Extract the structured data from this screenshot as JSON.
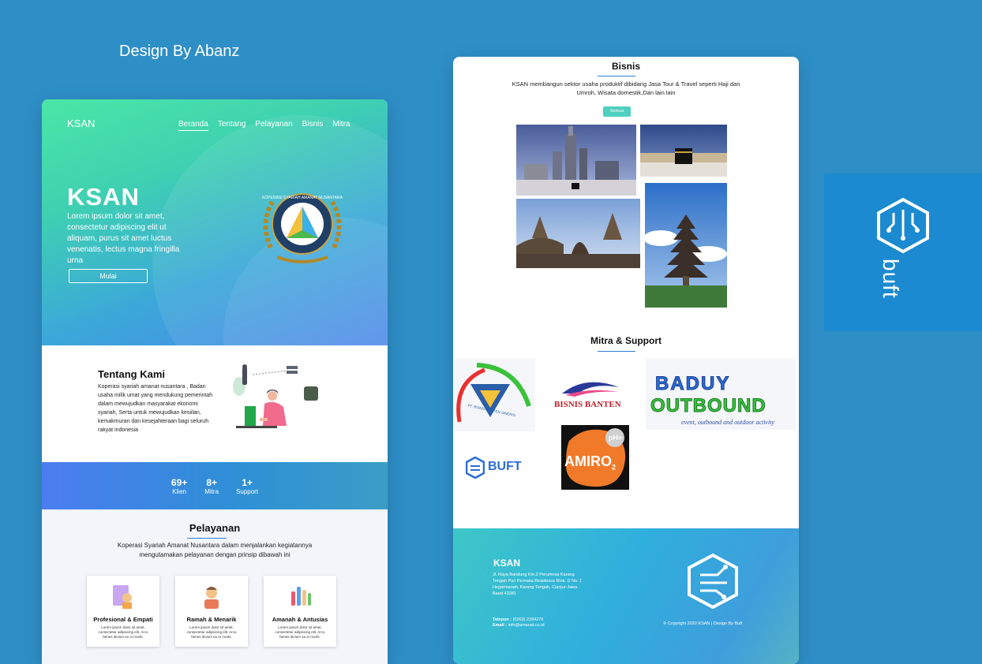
{
  "credit": "Design By Abanz",
  "left_page": {
    "nav": {
      "brand": "KSAN",
      "items": [
        "Beranda",
        "Tentang",
        "Pelayanan",
        "Bisnis",
        "Mitra"
      ],
      "active": "Beranda"
    },
    "hero": {
      "title": "KSAN",
      "text": "Lorem ipsum dolor sit amet, consectetur adipiscing elit ut aliquam, purus sit amet luctus venenatis, lectus magna fringilla urna",
      "button": "Mulai",
      "emblem_text": "KOPERASI SYARIAH AMANAT NUSANTARA"
    },
    "about": {
      "title": "Tentang Kami",
      "text": "Koperasi syariah amanat nusantara , Badan usaha milik umat yang mendukung pemerintah dalam mewujudkan masyarakat ekonomi syariah, Serta untuk mewujudkan kesiilan, kemakmuran dan kesejahteraan bagi seluruh rakyat indonesia"
    },
    "stats": [
      {
        "num": "69+",
        "label": "Klien"
      },
      {
        "num": "8+",
        "label": "Mitra"
      },
      {
        "num": "1+",
        "label": "Support"
      }
    ],
    "services": {
      "title": "Pelayanan",
      "text": "Koperasi Syariah Amanat Nusantara dalam menjalankan kegiatannya mengutamakan pelayanan  dengan prinsip dibawah ini",
      "cards": [
        {
          "title": "Profesional & Empati",
          "text": "Lorem ipsum dolor sit amet, consectetur adipiscing elit. Arcu fames dictum eu in morbi."
        },
        {
          "title": "Ramah & Menarik",
          "text": "Lorem ipsum dolor sit amet, consectetur adipiscing elit. Arcu fames dictum eu in morbi."
        },
        {
          "title": "Amanah  & Antusias",
          "text": "Lorem ipsum dolor sit amet, consectetur adipiscing elit. Arcu fames dictum eu in morbi."
        }
      ]
    }
  },
  "right_page": {
    "bisnis": {
      "title": "Bisnis",
      "text": "KSAN membangun sektor usaha produktif dibidang Jasa Tour & Travel seperti Haji dan Umroh, Wisata domestik,Dan lain lain",
      "button": "Semua"
    },
    "mitra": {
      "title": "Mitra & Support",
      "logos": {
        "sinergi": "PT. BISNIS BANTEN SINERGI",
        "bisnis_banten": "BISNIS BANTEN",
        "baduy_line1": "BADUY",
        "baduy_line2": "OUTBOUND",
        "baduy_tag": "event, outbound and outdoor activity",
        "buft": "BUFT",
        "amiro": "AMIRO",
        "amiro_sub": "2",
        "amiro_ph": "pH+"
      }
    },
    "footer": {
      "brand": "KSAN",
      "address": "Jl. Raya Bandung Km.2 Perumnas Karang Tengah Puri Permata Residence Blok. D No. 1 Hegarmanah, Karang Tengah, Cianjur-Jawa Barat 43281",
      "phone_label": "Telepon :",
      "phone": "(0263) 2284275",
      "email_label": "Email :",
      "email": "info@amanat.co.id",
      "copyright": "© Copyright 2020 KSAN | Design By Buft"
    }
  },
  "side_brand": {
    "name": "buft"
  }
}
